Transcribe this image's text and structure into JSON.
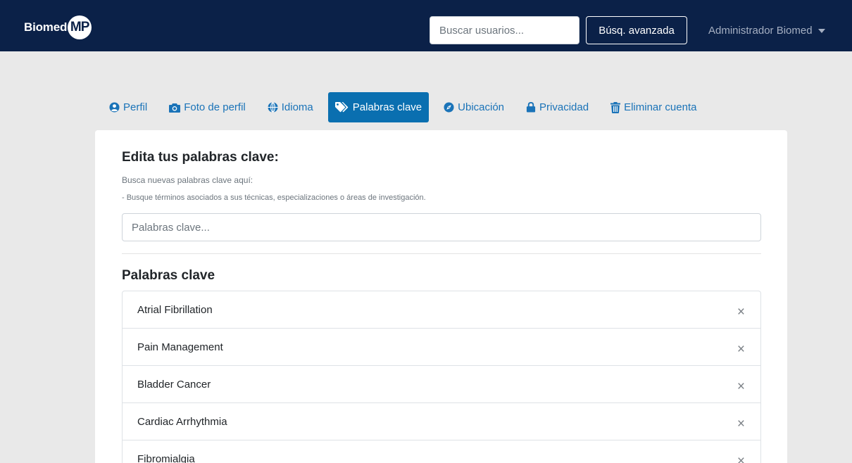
{
  "navbar": {
    "brand_text": "Biomed",
    "brand_badge": "MP",
    "search_placeholder": "Buscar usuarios...",
    "advanced_search_label": "Búsq. avanzada",
    "user_name": "Administrador Biomed"
  },
  "tabs": [
    {
      "label": "Perfil",
      "icon": "user-circle-icon",
      "active": false
    },
    {
      "label": "Foto de perfil",
      "icon": "camera-icon",
      "active": false
    },
    {
      "label": "Idioma",
      "icon": "globe-icon",
      "active": false
    },
    {
      "label": "Palabras clave",
      "icon": "tags-icon",
      "active": true
    },
    {
      "label": "Ubicación",
      "icon": "compass-icon",
      "active": false
    },
    {
      "label": "Privacidad",
      "icon": "lock-icon",
      "active": false
    },
    {
      "label": "Eliminar cuenta",
      "icon": "trash-icon",
      "active": false
    }
  ],
  "editor": {
    "title": "Edita tus palabras clave:",
    "help_line_1": "Busca nuevas palabras clave aquí:",
    "help_line_2": "- Busque términos asociados a sus técnicas, especializaciones o áreas de investigación.",
    "input_placeholder": "Palabras clave...",
    "list_title": "Palabras clave"
  },
  "keywords": [
    {
      "label": "Atrial Fibrillation",
      "remove": "×"
    },
    {
      "label": "Pain Management",
      "remove": "×"
    },
    {
      "label": "Bladder Cancer",
      "remove": "×"
    },
    {
      "label": "Cardiac Arrhythmia",
      "remove": "×"
    },
    {
      "label": "Fibromialgia",
      "remove": "×"
    }
  ],
  "colors": {
    "navbar_bg": "#0b2148",
    "accent": "#0a6fb0",
    "tab_text": "#1a73b8",
    "page_bg": "#e9e9e9"
  }
}
